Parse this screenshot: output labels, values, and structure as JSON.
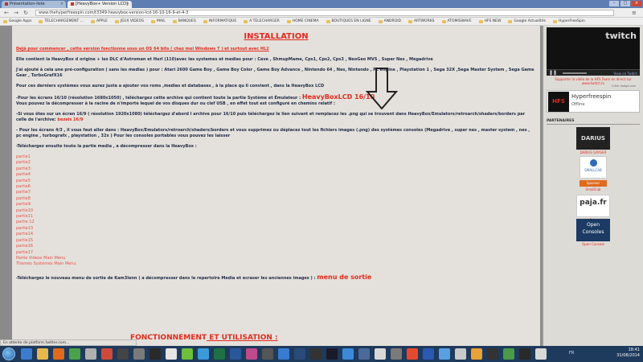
{
  "browser": {
    "tabs": [
      {
        "title": "Présentation-liste"
      },
      {
        "title": "[HeavyBox+ Version LCD]"
      }
    ],
    "url": "www.thehyperfreespin.com/t3349-heavybox-version-lcd-16-10-16-9-et-4-3",
    "bookmarks": [
      "Google Apps",
      "TELECHARGEMENT ...",
      "APPLE",
      "JEUX VIDEOS",
      "MAIL",
      "BANQUES",
      "INFORMATIQUE",
      "A TELECHARGER",
      "HOME CINEMA",
      "BOUTIQUES EN LIGNE",
      "ANDROID",
      "ARTWORKS",
      "ATOMISWAVE",
      "HFS NEW",
      "Google Actualités",
      "HyperFreeSpin"
    ],
    "status_text": "En attente de platform.twitter.com..."
  },
  "article": {
    "heading": "INSTALLATION",
    "intro_red": "Déjà pour commencer , cette version fonctionne sous un OS 64 bits ( chez moi Windows 7 ) et surtout avec HL2",
    "p1": "Elle contient la HeavyBox d origine + les DLC d'Astroman et Hurl (110)avec les systemes et medias pour : Cave , ShmupMame, Cps1, Cps2, Cps3 , NeoGeo MVS , Super Nes , Megadrive",
    "p2": "J'ai ajouté à cela une pré-configuration ( sans les medias ) pour : Atari 2600 Game Boy , Game Boy Color , Game Boy Advance , Nintendo 64 , Nes, Nintendo , Pc engine , Playstation 1 , Sega 32X ,Sega Master System , Sega Game Gear , TurboGrafX16",
    "p3": "Pour ces derniers systèmes vous aurez juste a ajouter vos roms ,medias et databases , à la place qu il convient , dans la HeavyBox LCD",
    "p4_a": "-Pour les écrans 16/10 (résolution 1680x1050) , téléchargez cette archive qui contient toute la partie Système et Émulateur :",
    "p4_link": "HeavyBoxLCD 16/10",
    "p4_b": "Vous pouvez la décompresser à la racine de n'importe lequel de vos disques dur ou clef USB , en effet tout est configuré en chemins relatif :",
    "p5_a": "-Si vous êtes sur un écran 16/9 ( résolution 1920x1080) téléchargez d'abord l archive pour 16/10 puis téléchargez le lien suivant et remplacez les .png qui se trouvent dans HeavyBox/Emulators/retroarch/shaders/borders par celle de l'archive:",
    "p5_link": "bezels 16/9",
    "p6": "- Pour les écrans 4/3 , il vous faut aller dans : HeavyBox/Emulators/retroarch/shaders/borders et vous supprimez ou déplacez tout les fichiers images (.png) des systèmes consoles (Megadrive , super nes , master system , nes , pc engine , turbografx , playstation , 32x ) Pour les consoles portables vous pouvez les laisser",
    "p7": "-Téléchargez ensuite toute la partie media , a décompresser dans la HeavyBox :",
    "parts": [
      "partie1",
      "partie2",
      "partie3",
      "partie4",
      "partie5",
      "partie6",
      "partie7",
      "partie8",
      "partie9",
      "partie10",
      "partie11",
      "partie 12",
      "partie13",
      "partie14",
      "partie15",
      "partie16",
      "partie17",
      "Partie Videos Main Menu",
      "Themes Systèmes Main Menu"
    ],
    "p8_a": "-Téléchargez le nouveau menu de sortie de Kam3lenn ( a décompresser dans le repertoire Media et ecraser les anciennes images ) :",
    "p8_link": "menu de sortie",
    "heading2_a": "FONCTIONNEMENT",
    "heading2_b": " ET UTILISATION :"
  },
  "sidebar": {
    "twitch_logo": "twitch",
    "twitch_badge": "View on Twitch",
    "support_text": "Supporter la vidéo de la HFS Team en direct sur www.twitch.tv",
    "credit": "Créer badge.com",
    "channel_logo": "HFS",
    "channel_name": "Hyperfreespin",
    "channel_status": "Offline",
    "partners_title": "PARTENAIRES",
    "partners": [
      {
        "logo": "DARIUS",
        "caption": "DARIUS GAYGER"
      },
      {
        "logo": "SMALLCAB",
        "badge": "Sponsor",
        "caption": "SmallCab"
      },
      {
        "logo": "paja.fr",
        "caption": "Paja"
      },
      {
        "logo_line1": "Open",
        "logo_line2": "Consoles",
        "caption": "Open Console"
      }
    ]
  },
  "taskbar": {
    "lang": "FR",
    "time": "18:41",
    "date": "31/08/2014"
  },
  "colors": {
    "accent_red": "#e42a1d",
    "text_navy": "#1f2a47",
    "page_bg": "#e4e1dc",
    "taskbar": "#1e3a5c"
  }
}
